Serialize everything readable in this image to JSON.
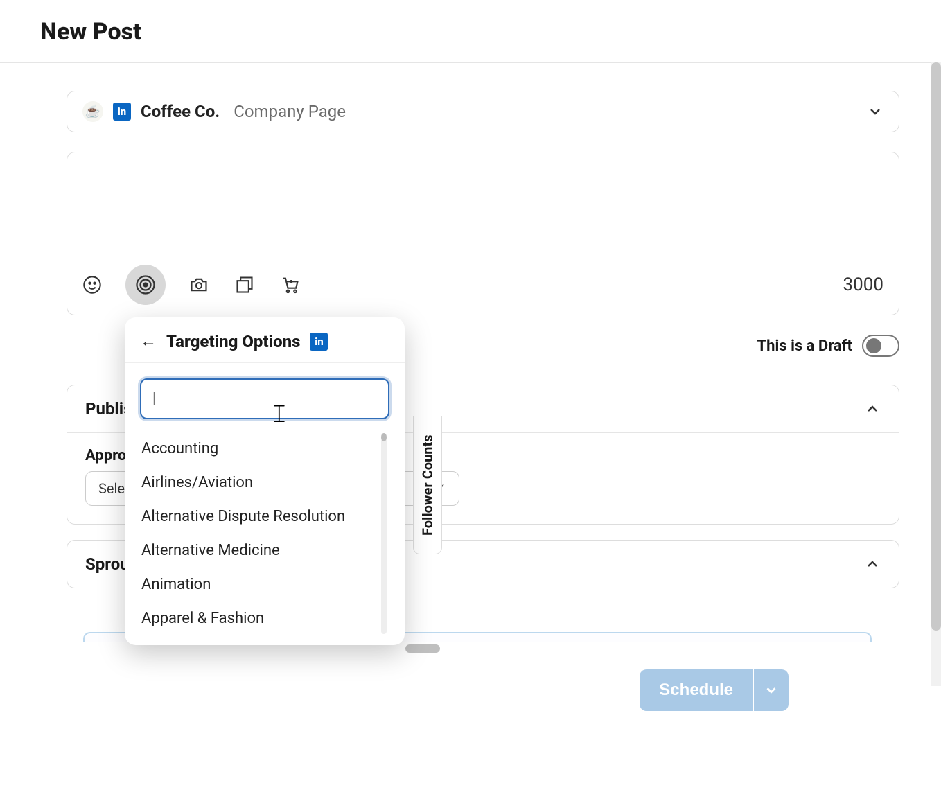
{
  "header": {
    "title": "New Post"
  },
  "profile": {
    "name": "Coffee Co.",
    "subtitle": "Company Page",
    "network_badge": "in"
  },
  "composer": {
    "char_remaining": "3000"
  },
  "draft_toggle": {
    "label": "This is a Draft",
    "on": false
  },
  "sections": {
    "publishing": {
      "title_visible": "Publis",
      "approval_label_visible": "Appro",
      "select_placeholder_visible": "Sele"
    },
    "sprout": {
      "title_visible": "Sprou"
    }
  },
  "follower_tab": {
    "label": "Follower Counts"
  },
  "targeting_popover": {
    "title": "Targeting Options",
    "network_badge": "in",
    "search_value": "",
    "caret": "|",
    "options": [
      "Accounting",
      "Airlines/Aviation",
      "Alternative Dispute Resolution",
      "Alternative Medicine",
      "Animation",
      "Apparel & Fashion"
    ]
  },
  "schedule_button": {
    "label": "Schedule"
  }
}
